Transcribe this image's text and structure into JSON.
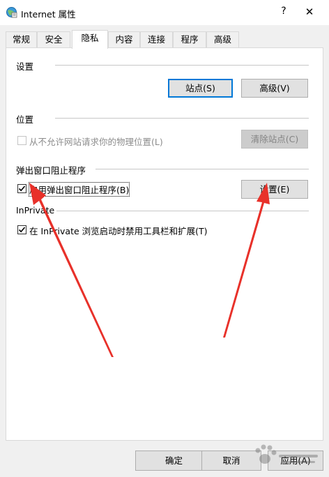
{
  "window": {
    "title": "Internet 属性",
    "help_glyph": "?",
    "close_glyph": "✕"
  },
  "tabs": [
    {
      "label": "常规"
    },
    {
      "label": "安全"
    },
    {
      "label": "隐私",
      "active": true
    },
    {
      "label": "内容"
    },
    {
      "label": "连接"
    },
    {
      "label": "程序"
    },
    {
      "label": "高级"
    }
  ],
  "settings_group": {
    "label": "设置",
    "sites_button": "站点(S)",
    "advanced_button": "高级(V)"
  },
  "location_group": {
    "label": "位置",
    "checkbox_label": "从不允许网站请求你的物理位置(L)",
    "checkbox_checked": false,
    "checkbox_enabled": false,
    "clear_sites_button": "清除站点(C)"
  },
  "popup_group": {
    "label": "弹出窗口阻止程序",
    "checkbox_label": "启用弹出窗口阻止程序(B)",
    "checkbox_checked": true,
    "settings_button": "设置(E)"
  },
  "inprivate_group": {
    "label": "InPrivate",
    "checkbox_label": "在 InPrivate 浏览启动时禁用工具栏和扩展(T)",
    "checkbox_checked": true
  },
  "footer": {
    "ok_button": "确定",
    "cancel_button": "取消",
    "apply_button": "应用(A)"
  },
  "colors": {
    "focus_accent": "#0078d7",
    "annotation_arrow": "#e8312a"
  }
}
